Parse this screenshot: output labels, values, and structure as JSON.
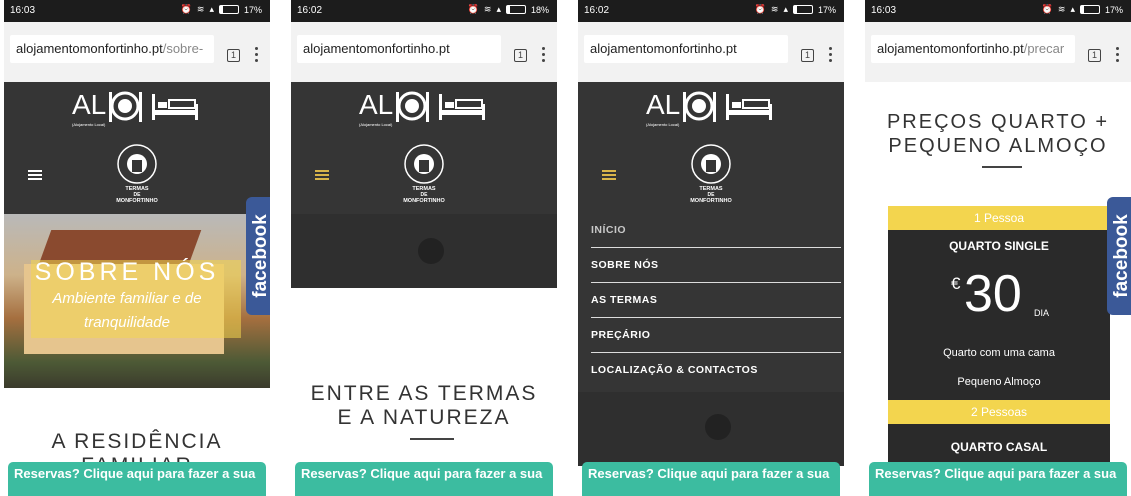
{
  "phones": [
    {
      "status": {
        "time": "16:03",
        "battery": "17%"
      },
      "url": {
        "main": "alojamentomonfortinho.pt",
        "path": "/sobre-"
      },
      "tab_count": "1",
      "hero": {
        "title": "SOBRE NÓS",
        "subtitle_line1": "Ambiente familiar e de",
        "subtitle_line2": "tranquilidade"
      },
      "section_title_line1": "A RESIDÊNCIA",
      "section_title_line2": "FAMILIAR",
      "facebook": "facebook",
      "reserve": "Reservas? Clique aqui para fazer a sua"
    },
    {
      "status": {
        "time": "16:02",
        "battery": "18%"
      },
      "url": {
        "main": "alojamentomonfortinho.pt",
        "path": ""
      },
      "tab_count": "1",
      "section_title_line1": "ENTRE AS TERMAS",
      "section_title_line2": "E A NATUREZA",
      "reserve": "Reservas? Clique aqui para fazer a sua"
    },
    {
      "status": {
        "time": "16:02",
        "battery": "17%"
      },
      "url": {
        "main": "alojamentomonfortinho.pt",
        "path": ""
      },
      "tab_count": "1",
      "menu": [
        "INÍCIO",
        "SOBRE NÓS",
        "AS TERMAS",
        "PREÇÁRIO",
        "LOCALIZAÇÃO & CONTACTOS"
      ],
      "reserve": "Reservas? Clique aqui para fazer a sua"
    },
    {
      "status": {
        "time": "16:03",
        "battery": "17%"
      },
      "url": {
        "main": "alojamentomonfortinho.pt",
        "path": "/precar"
      },
      "tab_count": "1",
      "section_title_line1": "PREÇOS QUARTO +",
      "section_title_line2": "PEQUENO ALMOÇO",
      "card": {
        "band1": "1 Pessoa",
        "room1": "QUARTO SINGLE",
        "currency": "€",
        "price": "30",
        "unit": "DIA",
        "line1": "Quarto com uma cama",
        "line2": "Pequeno Almoço",
        "band2": "2 Pessoas",
        "room2": "QUARTO CASAL"
      },
      "facebook": "facebook",
      "reserve": "Reservas? Clique aqui para fazer a sua"
    }
  ],
  "branding": {
    "logo_text": "AL",
    "logo_sub": "(Alojamento Local)",
    "crest_line1": "TERMAS",
    "crest_line2": "DE",
    "crest_line3": "MONFORTINHO"
  },
  "colors": {
    "accent_teal": "#3cbca0",
    "facebook_blue": "#3b5998",
    "price_yellow": "#f3d54e",
    "header_dark": "#353535"
  }
}
